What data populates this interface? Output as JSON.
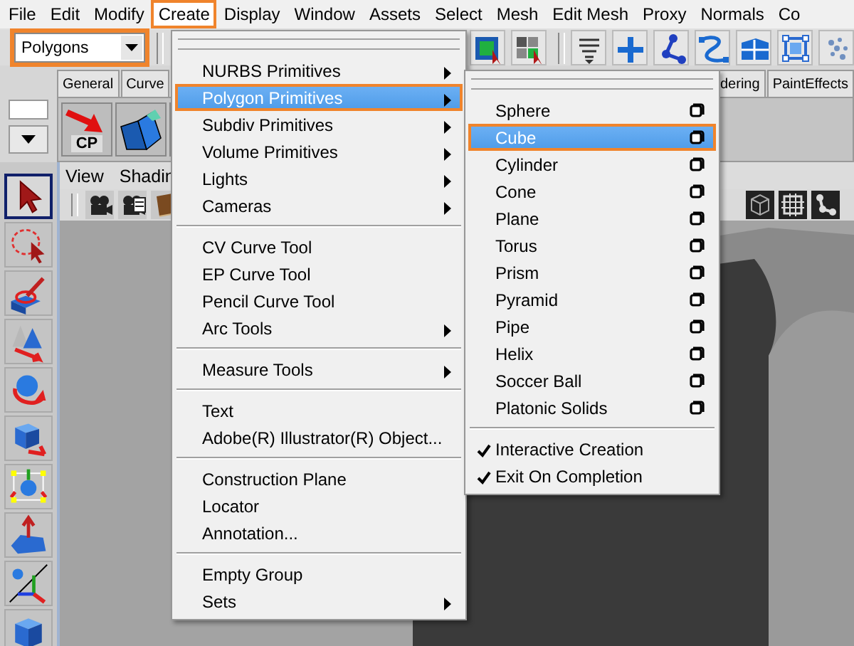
{
  "menu_bar": [
    {
      "label": "File",
      "selected": false,
      "callout": false
    },
    {
      "label": "Edit",
      "selected": false,
      "callout": false
    },
    {
      "label": "Modify",
      "selected": false,
      "callout": false
    },
    {
      "label": "Create",
      "selected": true,
      "callout": true
    },
    {
      "label": "Display",
      "selected": false,
      "callout": false
    },
    {
      "label": "Window",
      "selected": false,
      "callout": false
    },
    {
      "label": "Assets",
      "selected": false,
      "callout": false
    },
    {
      "label": "Select",
      "selected": false,
      "callout": false
    },
    {
      "label": "Mesh",
      "selected": false,
      "callout": false
    },
    {
      "label": "Edit Mesh",
      "selected": false,
      "callout": false
    },
    {
      "label": "Proxy",
      "selected": false,
      "callout": false
    },
    {
      "label": "Normals",
      "selected": false,
      "callout": false
    },
    {
      "label": "Co",
      "selected": false,
      "callout": false
    }
  ],
  "status_line": {
    "menu_set": {
      "value": "Polygons",
      "callout": true
    }
  },
  "shelf": {
    "button_label": "CP",
    "tabs_left": [
      {
        "label": "General"
      },
      {
        "label": "Curve"
      }
    ],
    "tabs_right": [
      {
        "label": "dering"
      },
      {
        "label": "PaintEffects"
      }
    ]
  },
  "toolbox": {
    "tools": [
      {
        "selected": true
      },
      {
        "selected": false
      },
      {
        "selected": false
      },
      {
        "selected": false
      },
      {
        "selected": false
      },
      {
        "selected": false
      },
      {
        "selected": false
      },
      {
        "selected": false
      },
      {
        "selected": false
      },
      {
        "selected": false
      }
    ]
  },
  "viewport": {
    "menus": [
      {
        "label": "View"
      },
      {
        "label": "Shadin"
      }
    ]
  },
  "create_menu": {
    "items": [
      {
        "kind": "item",
        "label": "NURBS Primitives",
        "submenu": true,
        "selected": false,
        "callout": false
      },
      {
        "kind": "item",
        "label": "Polygon Primitives",
        "submenu": true,
        "selected": true,
        "callout": true
      },
      {
        "kind": "item",
        "label": "Subdiv Primitives",
        "submenu": true,
        "selected": false,
        "callout": false
      },
      {
        "kind": "item",
        "label": "Volume Primitives",
        "submenu": true,
        "selected": false,
        "callout": false
      },
      {
        "kind": "item",
        "label": "Lights",
        "submenu": true,
        "selected": false,
        "callout": false
      },
      {
        "kind": "item",
        "label": "Cameras",
        "submenu": true,
        "selected": false,
        "callout": false
      },
      {
        "kind": "separator"
      },
      {
        "kind": "item",
        "label": "CV Curve Tool",
        "submenu": false,
        "selected": false,
        "callout": false
      },
      {
        "kind": "item",
        "label": "EP Curve Tool",
        "submenu": false,
        "selected": false,
        "callout": false
      },
      {
        "kind": "item",
        "label": "Pencil Curve Tool",
        "submenu": false,
        "selected": false,
        "callout": false
      },
      {
        "kind": "item",
        "label": "Arc Tools",
        "submenu": true,
        "selected": false,
        "callout": false
      },
      {
        "kind": "separator"
      },
      {
        "kind": "item",
        "label": "Measure Tools",
        "submenu": true,
        "selected": false,
        "callout": false
      },
      {
        "kind": "separator"
      },
      {
        "kind": "item",
        "label": "Text",
        "submenu": false,
        "selected": false,
        "callout": false
      },
      {
        "kind": "item",
        "label": "Adobe(R) Illustrator(R) Object...",
        "submenu": false,
        "selected": false,
        "callout": false
      },
      {
        "kind": "separator"
      },
      {
        "kind": "item",
        "label": "Construction Plane",
        "submenu": false,
        "selected": false,
        "callout": false
      },
      {
        "kind": "item",
        "label": "Locator",
        "submenu": false,
        "selected": false,
        "callout": false
      },
      {
        "kind": "item",
        "label": "Annotation...",
        "submenu": false,
        "selected": false,
        "callout": false
      },
      {
        "kind": "separator"
      },
      {
        "kind": "item",
        "label": "Empty Group",
        "submenu": false,
        "selected": false,
        "callout": false
      },
      {
        "kind": "item",
        "label": "Sets",
        "submenu": true,
        "selected": false,
        "callout": false
      }
    ]
  },
  "polygon_submenu": {
    "items": [
      {
        "kind": "item",
        "label": "Sphere",
        "option_box": true,
        "selected": false,
        "callout": false
      },
      {
        "kind": "item",
        "label": "Cube",
        "option_box": true,
        "selected": true,
        "callout": true
      },
      {
        "kind": "item",
        "label": "Cylinder",
        "option_box": true,
        "selected": false,
        "callout": false
      },
      {
        "kind": "item",
        "label": "Cone",
        "option_box": true,
        "selected": false,
        "callout": false
      },
      {
        "kind": "item",
        "label": "Plane",
        "option_box": true,
        "selected": false,
        "callout": false
      },
      {
        "kind": "item",
        "label": "Torus",
        "option_box": true,
        "selected": false,
        "callout": false
      },
      {
        "kind": "item",
        "label": "Prism",
        "option_box": true,
        "selected": false,
        "callout": false
      },
      {
        "kind": "item",
        "label": "Pyramid",
        "option_box": true,
        "selected": false,
        "callout": false
      },
      {
        "kind": "item",
        "label": "Pipe",
        "option_box": true,
        "selected": false,
        "callout": false
      },
      {
        "kind": "item",
        "label": "Helix",
        "option_box": true,
        "selected": false,
        "callout": false
      },
      {
        "kind": "item",
        "label": "Soccer Ball",
        "option_box": true,
        "selected": false,
        "callout": false
      },
      {
        "kind": "item",
        "label": "Platonic Solids",
        "option_box": true,
        "selected": false,
        "callout": false
      },
      {
        "kind": "separator"
      },
      {
        "kind": "check",
        "label": "Interactive Creation",
        "checked": true
      },
      {
        "kind": "check",
        "label": "Exit On Completion",
        "checked": true
      }
    ]
  }
}
